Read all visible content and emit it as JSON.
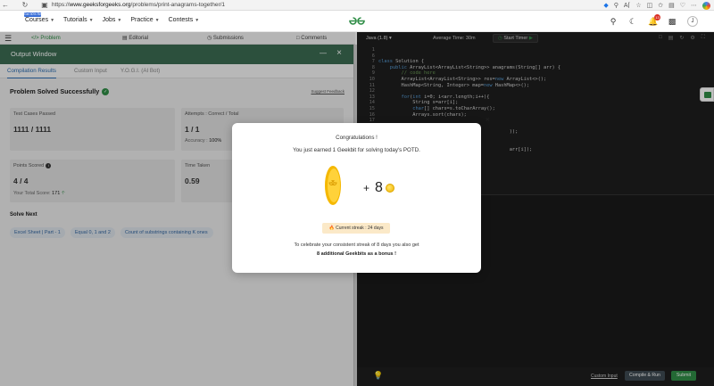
{
  "browser": {
    "url_prefix": "https://",
    "url_host": "www.geeksforgeeks.org",
    "url_path": "/problems/print-anagrams-together/1"
  },
  "site": {
    "promo": "Get 90% Refund",
    "nav": [
      {
        "label": "Courses"
      },
      {
        "label": "Tutorials"
      },
      {
        "label": "Jobs"
      },
      {
        "label": "Practice"
      },
      {
        "label": "Contests"
      }
    ],
    "notifications": "13",
    "avatar": "J"
  },
  "problem_tabs": [
    "Problem",
    "Editorial",
    "Submissions",
    "Comments"
  ],
  "editor_toolbar": {
    "language": "Java (1.8)",
    "avg_time": "Average Time: 30m",
    "start_timer": "Start Timer"
  },
  "output_window": {
    "title": "Output Window",
    "tabs": [
      "Compilation Results",
      "Custom Input",
      "Y.O.G.I. (AI Bot)"
    ],
    "solved_title": "Problem Solved Successfully",
    "suggest": "Suggest Feedback",
    "cards": {
      "test_cases": {
        "label": "Test Cases Passed",
        "value": "1111 / 1111"
      },
      "attempts": {
        "label": "Attempts : Correct / Total",
        "value": "1 / 1",
        "sub_label": "Accuracy :",
        "sub_value": "100%"
      },
      "points": {
        "label": "Points Scored",
        "value": "4 / 4",
        "sub_label": "Your Total Score:",
        "sub_value": "171"
      },
      "time": {
        "label": "Time Taken",
        "value": "0.59"
      }
    },
    "solve_next": "Solve Next",
    "chips": [
      "Excel Sheet | Part - 1",
      "Equal 0, 1 and 2",
      "Count of substrings containing K ones"
    ]
  },
  "code_lines": [
    {
      "n": "1",
      "html": ""
    },
    {
      "n": "6",
      "html": ""
    },
    {
      "n": "7",
      "html": "<span class='kw'>class</span> Solution {"
    },
    {
      "n": "8",
      "html": "    <span class='kw'>public</span> ArrayList&lt;ArrayList&lt;String&gt;&gt; anagrams(String[] arr) {"
    },
    {
      "n": "9",
      "html": "        <span class='cm'>// code here</span>"
    },
    {
      "n": "10",
      "html": "        ArrayList&lt;ArrayList&lt;String&gt;&gt; res=<span class='kw'>new</span> ArrayList&lt;&gt;();"
    },
    {
      "n": "11",
      "html": "        HashMap&lt;String, Integer&gt; map=<span class='kw'>new</span> HashMap&lt;&gt;();"
    },
    {
      "n": "12",
      "html": ""
    },
    {
      "n": "13",
      "html": "        <span class='kw'>for</span>(<span class='kw'>int</span> i=0; i&lt;arr.length;i++){"
    },
    {
      "n": "14",
      "html": "            String s=arr[i];"
    },
    {
      "n": "15",
      "html": "            <span class='kw'>char</span>[] chars=s.toCharArray();"
    },
    {
      "n": "16",
      "html": "            Arrays.sort(chars);"
    },
    {
      "n": "17",
      "html": ""
    },
    {
      "n": "18",
      "html": ""
    },
    {
      "n": "19",
      "html": "                                              ));"
    },
    {
      "n": "20",
      "html": ""
    },
    {
      "n": "21",
      "html": ""
    },
    {
      "n": "22",
      "html": "                                              arr[i]);"
    },
    {
      "n": "23",
      "html": ""
    },
    {
      "n": "24",
      "html": ""
    },
    {
      "n": "25",
      "html": ""
    },
    {
      "n": "26",
      "html": ""
    },
    {
      "n": "27",
      "html": ""
    },
    {
      "n": "28",
      "html": ""
    }
  ],
  "bottom_bar": {
    "custom_input": "Custom Input",
    "compile": "Compile & Run",
    "submit": "Submit"
  },
  "modal": {
    "title": "Congratulations !",
    "subtitle": "You just earned 1 Geekbit for solving today's POTD.",
    "plus": "+",
    "bonus_value": "8",
    "streak": "Current streak : 24 days",
    "body1": "To celebrate your consistent streak of 8 days you also get",
    "body2": "8 additional Geekbits as a bonus !"
  },
  "colors": {
    "brand_green": "#2f8d46",
    "output_bar": "#3b6b52",
    "link_blue": "#2b6cb0",
    "coin_gold": "#f0b400"
  }
}
